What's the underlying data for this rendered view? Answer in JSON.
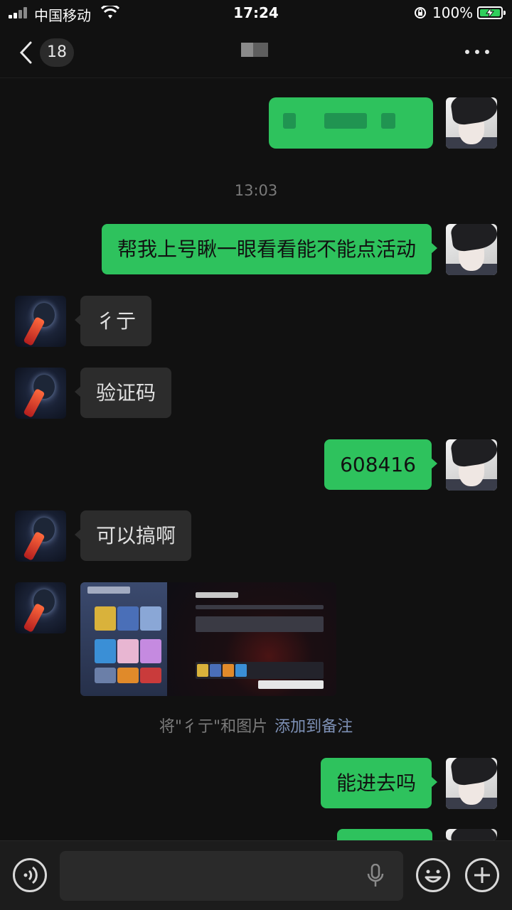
{
  "status_bar": {
    "carrier": "中国移动",
    "time": "17:24",
    "battery_percent": "100%",
    "battery_level": 1.0,
    "icons": [
      "signal-icon",
      "wifi-icon",
      "orientation-lock-icon",
      "battery-charging-icon"
    ]
  },
  "nav": {
    "unread_count": "18",
    "icons": [
      "back-chevron-icon",
      "more-dots-icon"
    ]
  },
  "timestamp": "13:03",
  "messages": [
    {
      "sender": "me",
      "type": "text",
      "text": "帮我上号瞅一眼看看能不能点活动"
    },
    {
      "sender": "other",
      "type": "text",
      "text": "彳亍"
    },
    {
      "sender": "other",
      "type": "text",
      "text": "验证码"
    },
    {
      "sender": "me",
      "type": "text",
      "text": "608416"
    },
    {
      "sender": "other",
      "type": "text",
      "text": "可以搞啊"
    },
    {
      "sender": "other",
      "type": "image",
      "text": ""
    },
    {
      "sender": "me",
      "type": "text",
      "text": "能进去吗"
    }
  ],
  "notice": {
    "prefix": "将\"彳亍\"和图片",
    "link": "添加到备注"
  },
  "colors": {
    "background": "#111111",
    "my_bubble": "#2ec25d",
    "other_bubble": "#2c2c2c",
    "notice_link": "#7d90b5"
  },
  "input_bar": {
    "icons": [
      "voice-icon",
      "mic-icon",
      "emoji-icon",
      "plus-icon"
    ]
  }
}
